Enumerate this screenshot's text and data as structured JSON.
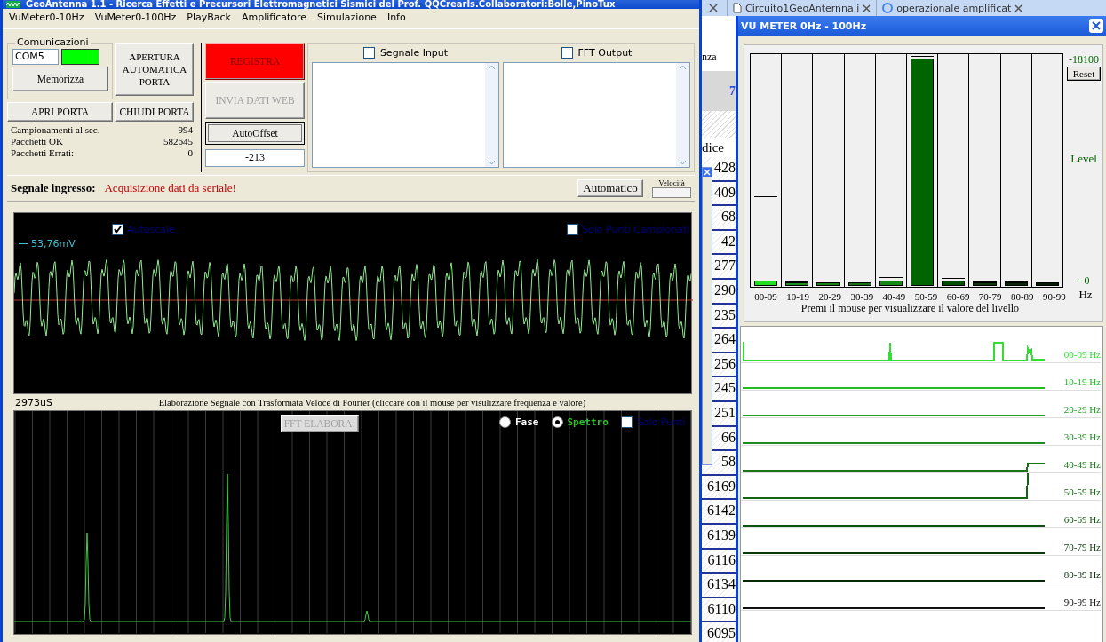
{
  "main_window": {
    "title": "GeoAntenna 1.1 - Ricerca Effetti e Precursori Elettromagnetici Sismici del Prof. QQCrearIs.Collaboratori:Bolle,PinoTux",
    "menu": [
      "VuMeter0-10Hz",
      "VuMeter0-100Hz",
      "PlayBack",
      "Amplificatore",
      "Simulazione",
      "Info"
    ],
    "communications": {
      "title": "Comunicazioni",
      "port": "COM5",
      "connected": true,
      "save_button": {
        "label": "Memorizza",
        "disabled": false
      }
    },
    "auto_open_button": {
      "label": "APERTURA AUTOMATICA PORTA",
      "disabled": false
    },
    "open_button": {
      "label": "APRI PORTA",
      "disabled": false
    },
    "close_button": {
      "label": "CHIUDI PORTA",
      "disabled": false
    },
    "stats": [
      {
        "label": "Campionamenti al sec.",
        "value": "994"
      },
      {
        "label": "Pacchetti OK",
        "value": "582645"
      },
      {
        "label": "Pacchetti Errati:",
        "value": "0"
      }
    ],
    "record_button": {
      "label": "REGISTRA",
      "disabled": false
    },
    "web_button": {
      "label": "INVIA DATI WEB",
      "disabled": true
    },
    "offset_button": {
      "label": "AutoOffset",
      "disabled": false
    },
    "offset_value": "-213",
    "logs": [
      {
        "label": "Segnale Input",
        "checked": false
      },
      {
        "label": "FFT Output",
        "checked": false
      }
    ],
    "signal": {
      "label": "Segnale ingresso:",
      "status": "Acquisizione dati da seriale!"
    },
    "auto_button": {
      "label": "Automatico",
      "disabled": false
    },
    "speed": {
      "label": "Velocità"
    },
    "scope": {
      "options": [
        {
          "label": "Autoscale",
          "checked": true
        },
        {
          "label": "Solo Punti Campionati",
          "checked": false
        }
      ],
      "scale": "53,76mV"
    },
    "time": "2973uS",
    "fft_caption": "Elaborazione Segnale con Trasformata Veloce di Fourier (cliccare con il mouse per visulizzare frequenza e valore)",
    "fft": {
      "button": {
        "label": "FFT ELABORA!",
        "disabled": true
      },
      "modes": [
        {
          "label": "Fase",
          "selected": false
        },
        {
          "label": "Spettro",
          "selected": true
        }
      ],
      "points": {
        "label": "Solo Punti",
        "checked": false
      }
    }
  },
  "browser": {
    "tabs": [
      {
        "label": "Circuito1GeoAnternna.i"
      },
      {
        "label": "operazionale amplificat"
      }
    ],
    "fragments": [
      "nza",
      "7"
    ],
    "column_heading": "dice",
    "cells": [
      "428",
      "409",
      "68",
      "42",
      "277",
      "290",
      "235",
      "264",
      "256",
      "245",
      "251",
      "66",
      "58",
      "6169",
      "6142",
      "6139",
      "6116",
      "6134",
      "6110",
      "6095"
    ]
  },
  "vu_window": {
    "title": "VU METER 0Hz - 100Hz",
    "max_label": "-18100",
    "reset_button": {
      "label": "Reset",
      "disabled": false
    },
    "axis_label": "Level",
    "min_label": "- 0",
    "unit": "Hz",
    "hint": "Premi il mouse per visualizzare il valore del livello",
    "bands": [
      {
        "label": "00-09",
        "level": 0.025,
        "color": "#22dd22",
        "peak": {
          "level": 0.39
        }
      },
      {
        "label": "10-19",
        "level": 0.008,
        "color": "#1f8f1f",
        "peak": {
          "level": 0.02
        }
      },
      {
        "label": "20-29",
        "level": 0.008,
        "color": "#1a801a",
        "peak": {
          "level": 0.022
        }
      },
      {
        "label": "30-39",
        "level": 0.008,
        "color": "#167016",
        "peak": {
          "level": 0.024
        }
      },
      {
        "label": "40-49",
        "level": 0.025,
        "color": "#138813",
        "peak": {
          "level": 0.037
        }
      },
      {
        "label": "50-59",
        "level": 0.985,
        "color": "#006400",
        "peak": {
          "level": 0.995
        }
      },
      {
        "label": "60-69",
        "level": 0.025,
        "color": "#004d00",
        "peak": {
          "level": 0.035
        }
      },
      {
        "label": "70-79",
        "level": 0.008,
        "color": "#0c380c",
        "peak": {
          "level": 0.02
        }
      },
      {
        "label": "80-89",
        "level": 0.008,
        "color": "#082808",
        "peak": {
          "level": 0.02
        }
      },
      {
        "label": "90-99",
        "level": 0.008,
        "color": "#041a04",
        "peak": {
          "level": 0.024
        }
      }
    ],
    "traces": [
      {
        "label": "00-09 Hz",
        "color": "#33dd33"
      },
      {
        "label": "10-19 Hz",
        "color": "#22bb22"
      },
      {
        "label": "20-29 Hz",
        "color": "#22a022"
      },
      {
        "label": "30-39 Hz",
        "color": "#1f8a1f"
      },
      {
        "label": "40-49 Hz",
        "color": "#1a751a"
      },
      {
        "label": "50-59 Hz",
        "color": "#146414"
      },
      {
        "label": "60-69 Hz",
        "color": "#0f520f"
      },
      {
        "label": "70-79 Hz",
        "color": "#0a3c0a"
      },
      {
        "label": "80-89 Hz",
        "color": "#062806"
      },
      {
        "label": "90-99 Hz",
        "color": "#111111"
      }
    ]
  }
}
